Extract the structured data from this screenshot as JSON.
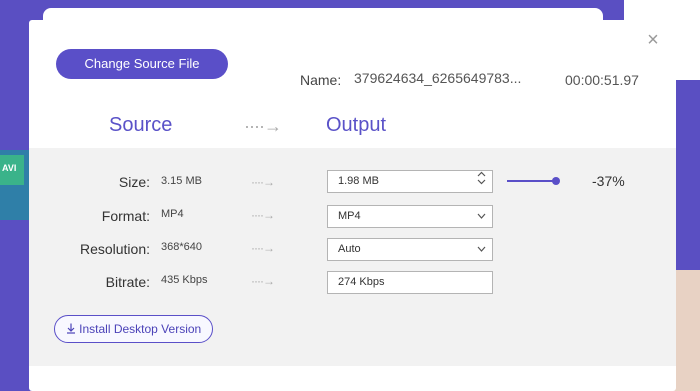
{
  "dialog": {
    "change_source_label": "Change Source File",
    "name_label": "Name:",
    "file_name": "379624634_6265649783...",
    "duration": "00:00:51.97",
    "source_header": "Source",
    "output_header": "Output",
    "close_symbol": "×",
    "arrow_symbol": "····→"
  },
  "rows": [
    {
      "label": "Size:",
      "source": "3.15  MB",
      "output": "1.98  MB",
      "control": "stepper"
    },
    {
      "label": "Format:",
      "source": "MP4",
      "output": "MP4",
      "control": "dropdown"
    },
    {
      "label": "Resolution:",
      "source": "368*640",
      "output": "Auto",
      "control": "dropdown"
    },
    {
      "label": "Bitrate:",
      "source": "435  Kbps",
      "output": "274 Kbps",
      "control": "text"
    }
  ],
  "compression": {
    "percent_text": "-37%",
    "slider_value": 0.94
  },
  "install_label": "Install Desktop Version",
  "icons": {
    "close": "close-icon",
    "stepper": "updown-chevron-icon",
    "dropdown": "chevron-down-icon",
    "download": "download-icon"
  },
  "colors": {
    "accent": "#5a4fc8",
    "background": "#5a4fc2",
    "panel": "#f2f2f2"
  }
}
